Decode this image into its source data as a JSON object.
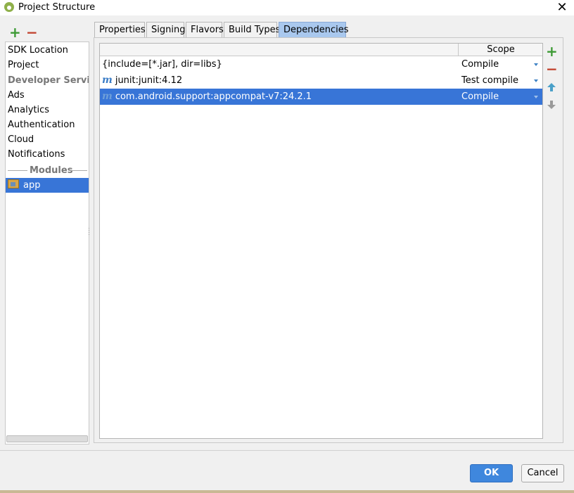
{
  "window": {
    "title": "Project Structure",
    "close_glyph": "✕"
  },
  "left_toolbar": {
    "add_glyph": "+",
    "remove_glyph": "−"
  },
  "left_panel": {
    "items_top": [
      "SDK Location",
      "Project"
    ],
    "services_header": "Developer Services",
    "services": [
      "Ads",
      "Analytics",
      "Authentication",
      "Cloud",
      "Notifications"
    ],
    "modules_header": "Modules",
    "modules": [
      {
        "label": "app",
        "selected": true
      }
    ]
  },
  "tabs": [
    {
      "label": "Properties"
    },
    {
      "label": "Signing"
    },
    {
      "label": "Flavors"
    },
    {
      "label": "Build Types"
    },
    {
      "label": "Dependencies",
      "active": true
    }
  ],
  "table": {
    "header_scope": "Scope",
    "rows": [
      {
        "name": "{include=[*.jar], dir=libs}",
        "scope": "Compile",
        "icon": "",
        "selected": false
      },
      {
        "name": "junit:junit:4.12",
        "scope": "Test compile",
        "icon": "m",
        "selected": false
      },
      {
        "name": "com.android.support:appcompat-v7:24.2.1",
        "scope": "Compile",
        "icon": "m",
        "selected": true
      }
    ]
  },
  "right_toolbar": {
    "add_glyph": "+",
    "remove_glyph": "−"
  },
  "buttons": {
    "ok": "OK",
    "cancel": "Cancel"
  },
  "colors": {
    "selection": "#3875d7",
    "active_tab": "#a9c8ee",
    "ok_button": "#3f87dd",
    "add": "#3d9a35",
    "remove": "#c2432f"
  }
}
